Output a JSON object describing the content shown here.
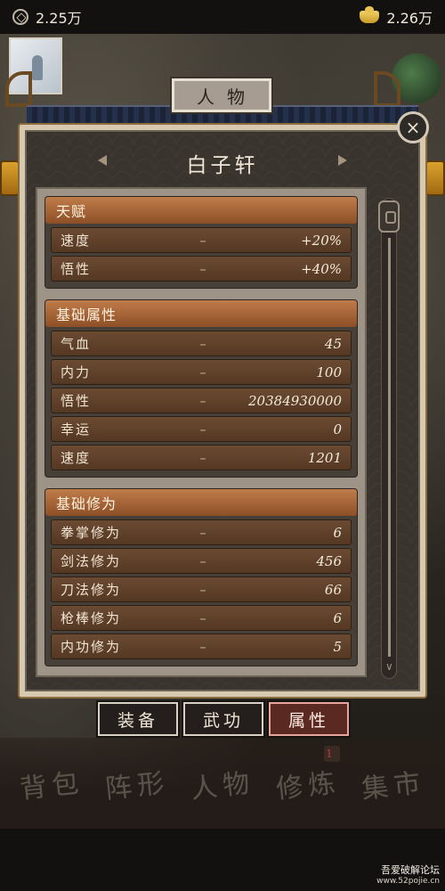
{
  "topbar": {
    "coins": "2.25万",
    "gold": "2.26万"
  },
  "header": {
    "title": "人物",
    "character_name": "白子轩",
    "close": "×"
  },
  "sections": [
    {
      "title": "天赋",
      "rows": [
        {
          "label": "速度",
          "dash": "–",
          "value": "+20%"
        },
        {
          "label": "悟性",
          "dash": "–",
          "value": "+40%"
        }
      ]
    },
    {
      "title": "基础属性",
      "rows": [
        {
          "label": "气血",
          "dash": "–",
          "value": "45"
        },
        {
          "label": "内力",
          "dash": "–",
          "value": "100"
        },
        {
          "label": "悟性",
          "dash": "–",
          "value": "20384930000"
        },
        {
          "label": "幸运",
          "dash": "–",
          "value": "0"
        },
        {
          "label": "速度",
          "dash": "–",
          "value": "1201"
        }
      ]
    },
    {
      "title": "基础修为",
      "rows": [
        {
          "label": "拳掌修为",
          "dash": "–",
          "value": "6"
        },
        {
          "label": "剑法修为",
          "dash": "–",
          "value": "456"
        },
        {
          "label": "刀法修为",
          "dash": "–",
          "value": "66"
        },
        {
          "label": "枪棒修为",
          "dash": "–",
          "value": "6"
        },
        {
          "label": "内功修为",
          "dash": "–",
          "value": "5"
        }
      ]
    }
  ],
  "tabs": [
    {
      "label": "装备",
      "active": false
    },
    {
      "label": "武功",
      "active": false
    },
    {
      "label": "属性",
      "active": true
    }
  ],
  "bottom_nav": [
    {
      "label": "背包"
    },
    {
      "label": "阵形"
    },
    {
      "label": "人物"
    },
    {
      "label": "修炼",
      "badge": "1"
    },
    {
      "label": "集市"
    }
  ],
  "watermark": {
    "line1": "吾爱破解论坛",
    "line2": "www.52pojie.cn"
  },
  "colors": {
    "section_header": "#a8653a",
    "row_bg": "#5e412b",
    "active_tab": "#5a2a22"
  },
  "icons": [
    "coin-icon",
    "gold-ingot-icon",
    "close-icon",
    "scroll-thumb-icon",
    "chevron-down-icon"
  ]
}
